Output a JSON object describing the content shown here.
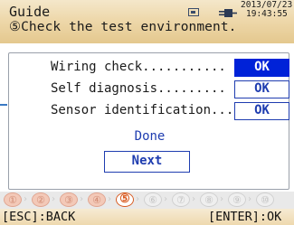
{
  "header": {
    "title": "Guide",
    "instruction": "⑤Check the test environment.",
    "date": "2013/07/23",
    "time": "19:43:55"
  },
  "checks": [
    {
      "label": "Wiring check...........",
      "result": "OK",
      "selected": true
    },
    {
      "label": "Self diagnosis.........",
      "result": "OK",
      "selected": false
    },
    {
      "label": "Sensor identification...",
      "result": "OK",
      "selected": false
    }
  ],
  "done_label": "Done",
  "next_label": "Next",
  "steps": {
    "items": [
      "①",
      "②",
      "③",
      "④",
      "⑤",
      "⑥",
      "⑦",
      "⑧",
      "⑨",
      "⑩"
    ],
    "current": 5
  },
  "footer": {
    "back_label": "[ESC]:BACK",
    "ok_label": "[ENTER]:OK"
  },
  "colors": {
    "accent": "#0022d8",
    "current_step": "#d85a20",
    "header_bg": "#eed8ab"
  }
}
